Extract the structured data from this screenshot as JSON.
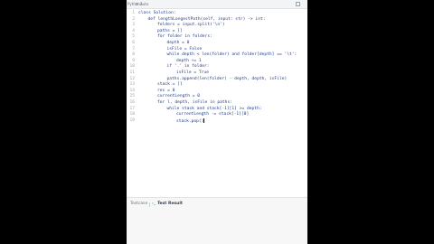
{
  "tabs": {
    "file_label": "Python3",
    "auto_label": "Auto"
  },
  "code_lines": [
    {
      "n": "1",
      "indent": 0,
      "text": "class Solution:"
    },
    {
      "n": "2",
      "indent": 1,
      "text": "def lengthLongestPath(self, input: str) -> int:"
    },
    {
      "n": "3",
      "indent": 2,
      "text": "folders = input.split('\\n')"
    },
    {
      "n": "4",
      "indent": 2,
      "text": "paths = []"
    },
    {
      "n": "5",
      "indent": 2,
      "text": "for folder in folders:"
    },
    {
      "n": "6",
      "indent": 3,
      "text": "depth = 0"
    },
    {
      "n": "7",
      "indent": 3,
      "text": "isFile = False"
    },
    {
      "n": "8",
      "indent": 3,
      "text": "while depth < len(folder) and folder[depth] == '\\t':"
    },
    {
      "n": "9",
      "indent": 4,
      "text": "depth += 1"
    },
    {
      "n": "10",
      "indent": 3,
      "text": "if '.' in folder:"
    },
    {
      "n": "11",
      "indent": 4,
      "text": "isFile = True"
    },
    {
      "n": "12",
      "indent": 3,
      "text": "paths.append(len(folder) - depth, depth, isFile)"
    },
    {
      "n": "13",
      "indent": 2,
      "text": "stack = []"
    },
    {
      "n": "14",
      "indent": 2,
      "text": "res = 0"
    },
    {
      "n": "15",
      "indent": 2,
      "text": "currentLength = 0"
    },
    {
      "n": "16",
      "indent": 2,
      "text": "for l, depth, isFile in paths:"
    },
    {
      "n": "17",
      "indent": 3,
      "text": "while stack and stack[-1][1] >= depth:"
    },
    {
      "n": "18",
      "indent": 4,
      "text": "currentLength -= stack[-1][0]"
    },
    {
      "n": "19",
      "indent": 4,
      "text": "stack.pop()"
    }
  ],
  "bottom_tabs": {
    "testcase": "Testcase",
    "test_result": "Test Result"
  }
}
